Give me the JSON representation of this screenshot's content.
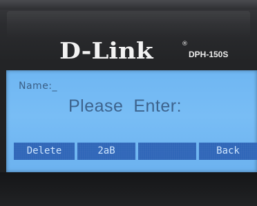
{
  "device": {
    "brand": "D-Link",
    "brand_mark": "®",
    "model": "DPH-150S"
  },
  "screen": {
    "label": "Name:_",
    "prompt": "Please  Enter:",
    "softkeys": [
      "Delete",
      "2aB",
      "",
      "Back"
    ]
  },
  "colors": {
    "lcd_background": "#74baf3",
    "lcd_text": "#3d638d",
    "softkey_background": "#2f66b8",
    "softkey_text": "#cfe6ff",
    "bezel": "#1e1f21"
  }
}
